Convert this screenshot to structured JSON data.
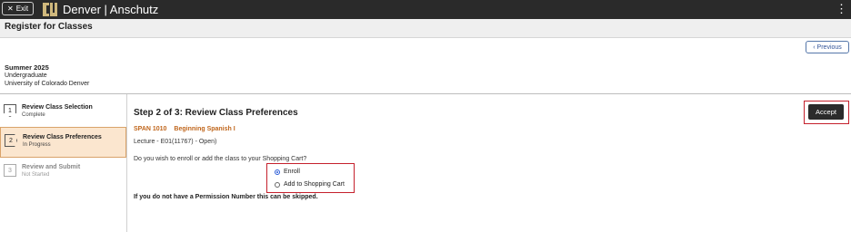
{
  "topbar": {
    "exit_label": "Exit",
    "brand": "Denver | Anschutz",
    "menu_icon": "kebab-menu-icon"
  },
  "page": {
    "title": "Register for Classes"
  },
  "nav": {
    "previous_label": "Previous"
  },
  "term": {
    "name": "Summer 2025",
    "career": "Undergraduate",
    "institution": "University of Colorado Denver"
  },
  "steps": [
    {
      "number": "1",
      "name": "Review Class Selection",
      "status": "Complete"
    },
    {
      "number": "2",
      "name": "Review Class Preferences",
      "status": "In Progress"
    },
    {
      "number": "3",
      "name": "Review and Submit",
      "status": "Not Started"
    }
  ],
  "main": {
    "heading": "Step 2 of 3: Review Class Preferences",
    "course_code": "SPAN 1010",
    "course_title": "Beginning Spanish I",
    "section": "Lecture - E01(11767) - Open)",
    "question": "Do you wish to enroll or add the class to your Shopping Cart?",
    "options": [
      {
        "label": "Enroll",
        "selected": true
      },
      {
        "label": "Add to Shopping Cart",
        "selected": false
      }
    ],
    "permission_note": "If you do not have a Permission Number this can be skipped.",
    "accept_label": "Accept"
  },
  "colors": {
    "accent": "#c0661c",
    "highlight": "#c5202c",
    "topbar": "#2a2a2a",
    "current_step_bg": "#fbe6cf"
  }
}
